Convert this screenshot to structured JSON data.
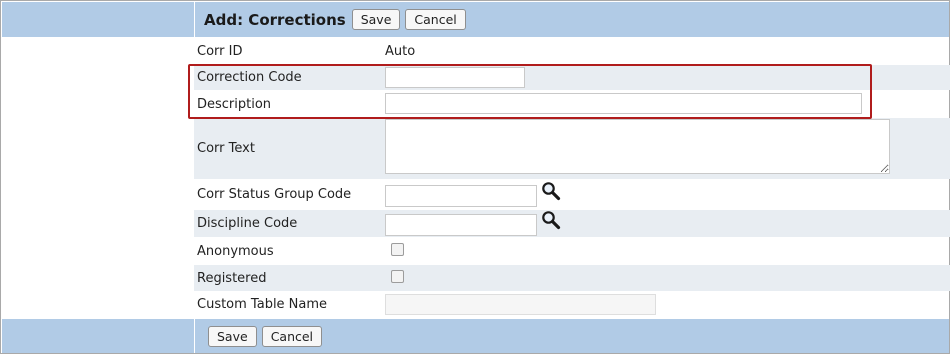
{
  "header": {
    "title": "Add: Corrections",
    "save_label": "Save",
    "cancel_label": "Cancel"
  },
  "footer": {
    "save_label": "Save",
    "cancel_label": "Cancel"
  },
  "form": {
    "corr_id": {
      "label": "Corr ID",
      "value": "Auto"
    },
    "correction_code": {
      "label": "Correction Code",
      "value": ""
    },
    "description": {
      "label": "Description",
      "value": ""
    },
    "corr_text": {
      "label": "Corr Text",
      "value": ""
    },
    "corr_status_group_code": {
      "label": "Corr Status Group Code",
      "value": "",
      "icon": "magnifier-icon"
    },
    "discipline_code": {
      "label": "Discipline Code",
      "value": "",
      "icon": "magnifier-icon"
    },
    "anonymous": {
      "label": "Anonymous",
      "checked": false
    },
    "registered": {
      "label": "Registered",
      "checked": false
    },
    "custom_table_name": {
      "label": "Custom Table Name",
      "value": "",
      "disabled": true
    }
  },
  "colors": {
    "header_bg": "#b1cbe6",
    "row_shade": "#e8edf2",
    "highlight_border": "#b01c1c"
  }
}
